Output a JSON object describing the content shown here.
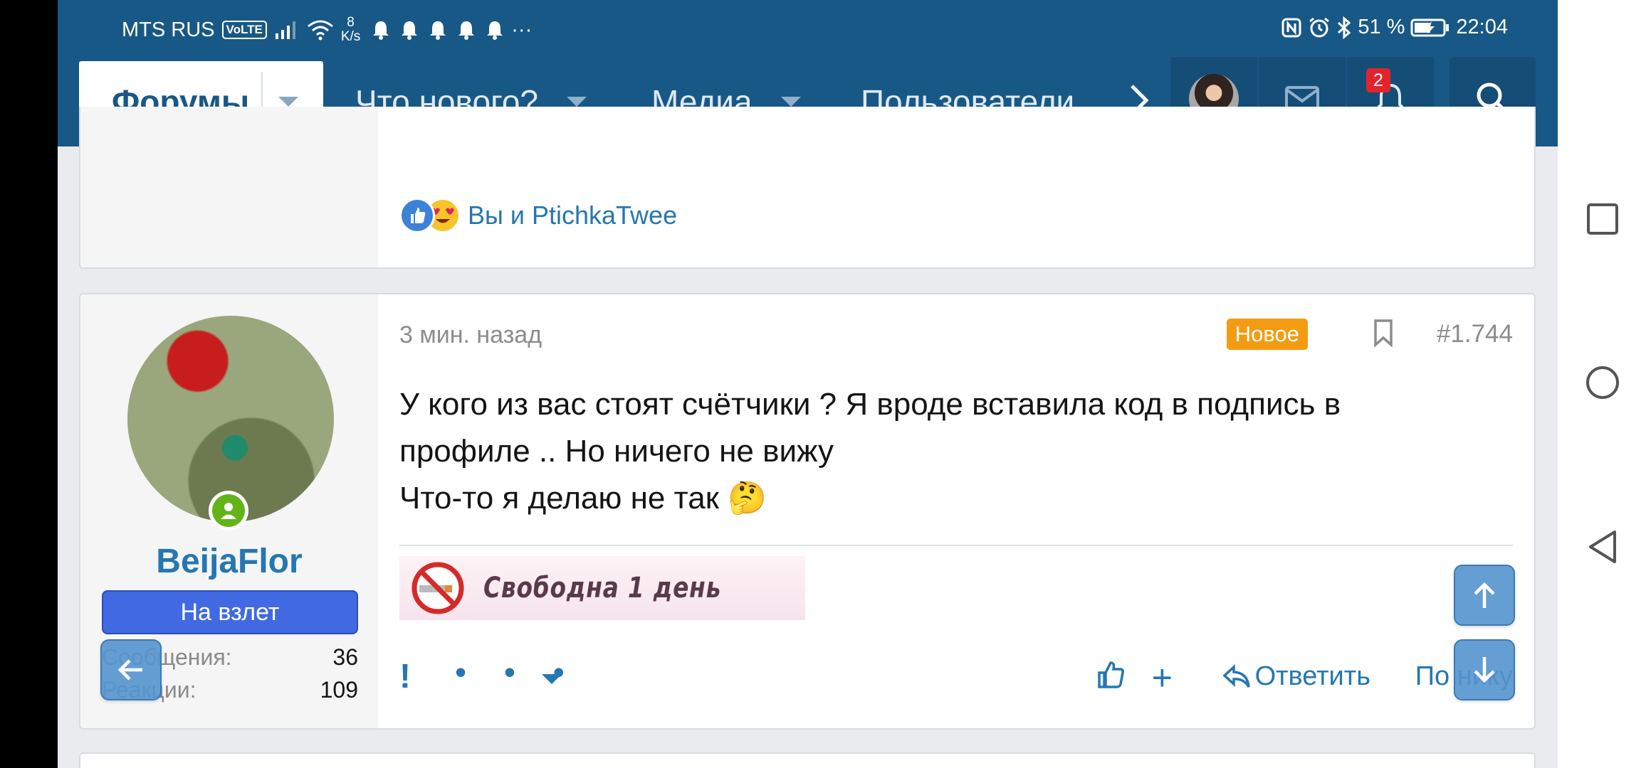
{
  "status_bar": {
    "carrier": "MTS RUS",
    "volte": "VoLTE",
    "speed_value": "8",
    "speed_unit": "K/s",
    "overflow": "···",
    "battery": "51 %",
    "time": "22:04"
  },
  "nav": {
    "forums": "Форумы",
    "whats_new": "Что нового?",
    "media": "Медиа",
    "members": "Пользователи",
    "notifications_count": "2"
  },
  "prev_post": {
    "reactions_text": "Вы и PtichkaTwee"
  },
  "post": {
    "date": "3 мин. назад",
    "new_badge": "Новое",
    "number": "#1.744",
    "username": "BeijaFlor",
    "user_title": "На взлет",
    "stats": [
      {
        "label": "Сообщения:",
        "value": "36"
      },
      {
        "label": "Реакции:",
        "value": "109"
      }
    ],
    "body_lines": [
      "У кого из вас стоят счётчики ? Я вроде вставила код в подпись в",
      "профиле .. Но ничего не вижу",
      "Что-то я делаю не так 🤔"
    ],
    "signature_text": "Свободна 1 день",
    "actions": {
      "report": "!",
      "more": "• • •",
      "plus": "+",
      "reply": "Ответить",
      "by_nick": "По нику"
    }
  },
  "colors": {
    "header": "#185886",
    "link": "#2577b1",
    "rank": "#4169e1",
    "new_badge": "#f39c12",
    "notif": "#e2232c"
  }
}
